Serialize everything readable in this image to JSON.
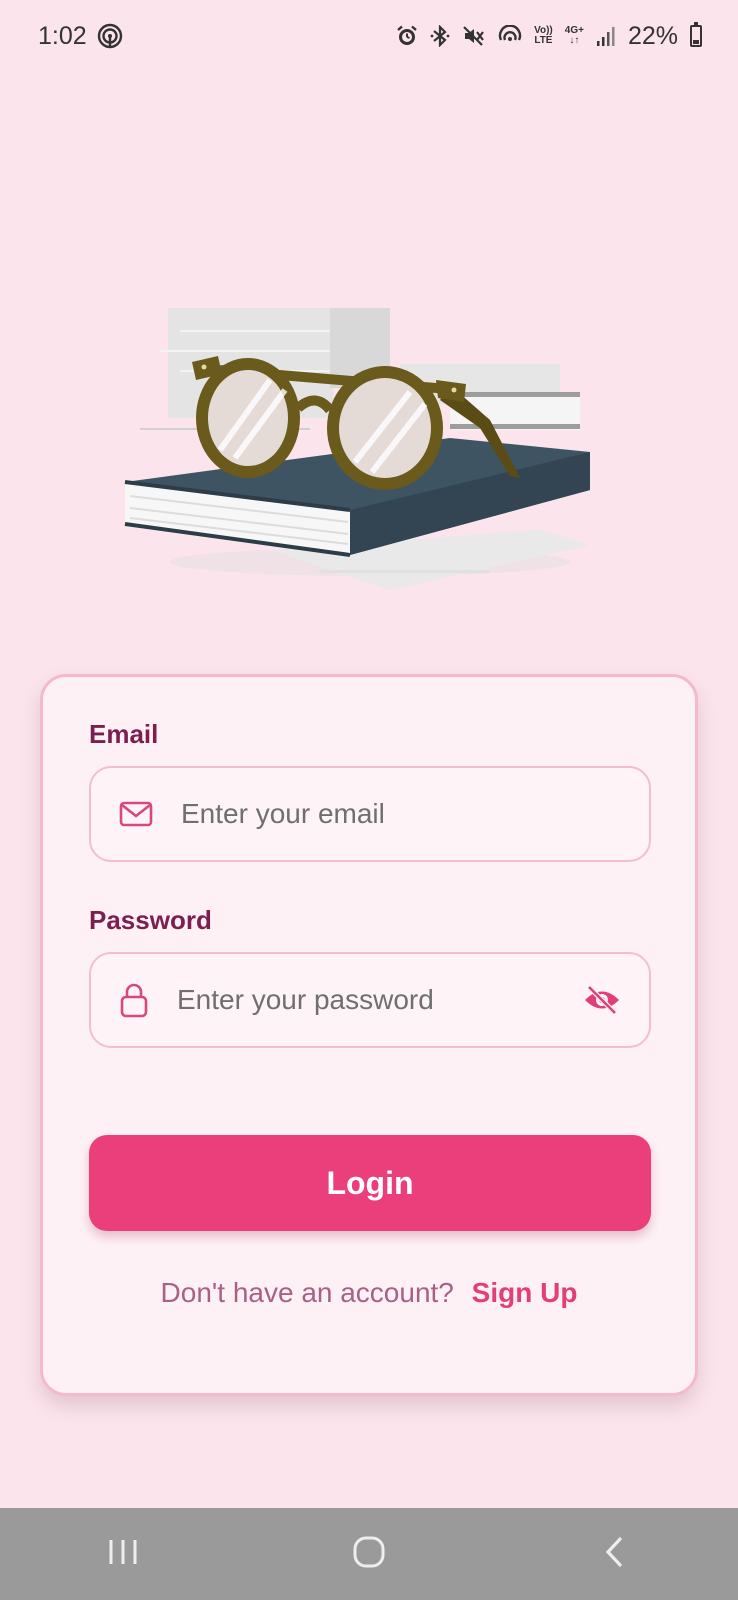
{
  "status_bar": {
    "time": "1:02",
    "lte_top": "Vo))",
    "lte_bottom": "LTE",
    "network": "4G+",
    "battery_percent": "22%"
  },
  "login_card": {
    "email_label": "Email",
    "email_placeholder": "Enter your email",
    "password_label": "Password",
    "password_placeholder": "Enter your password",
    "login_button": "Login",
    "signup_prompt": "Don't have an account?",
    "signup_link": "Sign Up"
  },
  "colors": {
    "background": "#fbe4ec",
    "accent": "#ea3f7a",
    "label": "#7a1f50",
    "card_border": "#f5b9cd"
  },
  "icons": {
    "email": "mail-icon",
    "password": "lock-icon",
    "toggle_password": "eye-off-icon"
  }
}
